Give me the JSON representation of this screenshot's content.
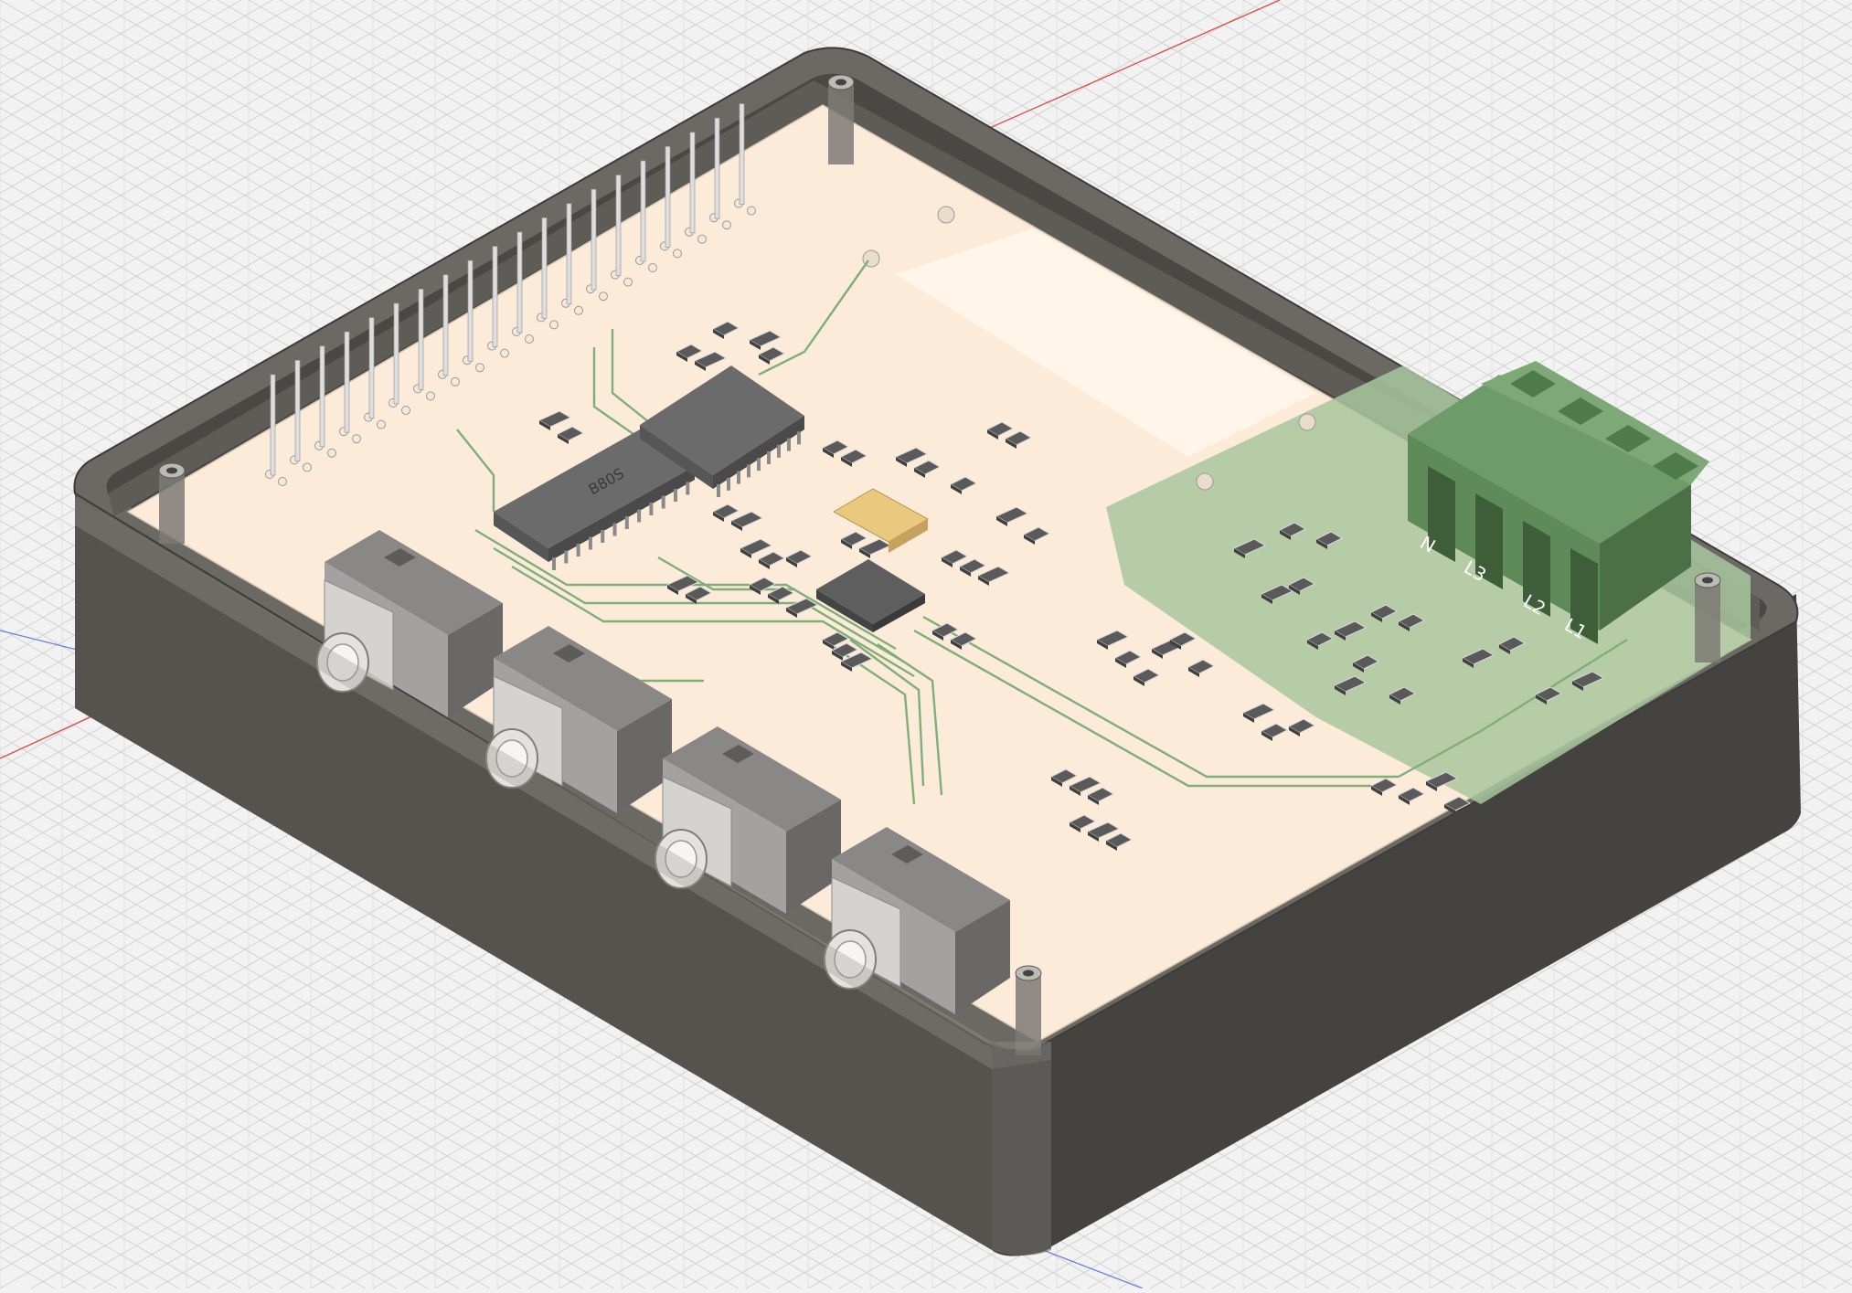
{
  "viewport": {
    "name": "3d-cad-viewport",
    "background": "#f2f2f2",
    "grid_color": "#d2d2d2",
    "axis_x_color": "#e04a4a",
    "axis_y_color": "#6a7fe0"
  },
  "model": {
    "enclosure_color": "#5c5a55",
    "enclosure_rim_color": "#8a8780",
    "pcb_color": "#fcebd9",
    "copper_pour_color": "#a8c79e",
    "trace_color": "#7fae7a",
    "chip_color": "#6b6b6b",
    "crystal_color": "#e9c97d"
  },
  "labels": {
    "ic_marking": "B80S",
    "terminal_n": "N",
    "terminal_l3": "L3",
    "terminal_l2": "L2",
    "terminal_l1": "L1"
  }
}
